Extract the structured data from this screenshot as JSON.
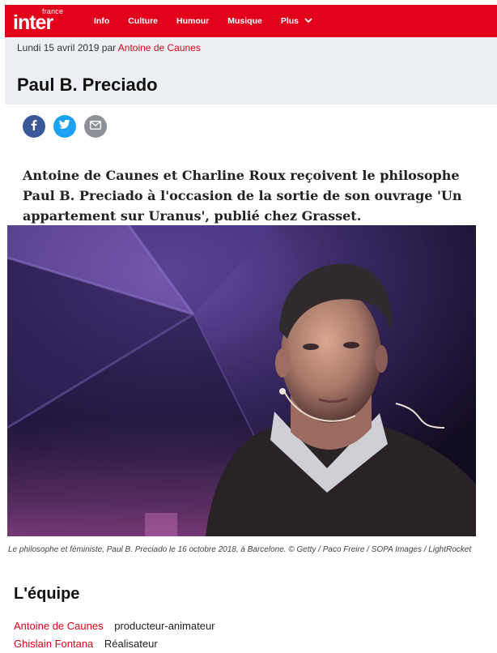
{
  "brand": {
    "small": "france",
    "big": "inter",
    "color": "#e2001a"
  },
  "nav": {
    "items": [
      "Info",
      "Culture",
      "Humour",
      "Musique"
    ],
    "plus_label": "Plus"
  },
  "article": {
    "date": "Lundi 15 avril 2019",
    "by": "par",
    "author": "Antoine de Caunes",
    "title": "Paul B. Preciado",
    "chapo": "Antoine de Caunes et Charline Roux reçoivent le philosophe Paul B. Preciado à l'occasion de la sortie de son ouvrage 'Un appartement sur Uranus', publié chez Grasset.",
    "caption": "Le philosophe et féministe, Paul B. Preciado le 16 octobre 2018, à Barcelone. © Getty / Paco Freire / SOPA Images / LightRocket"
  },
  "share": {
    "icons": [
      "facebook-icon",
      "twitter-icon",
      "mail-icon"
    ],
    "colors": {
      "facebook": "#3b5998",
      "twitter": "#1da1f2",
      "mail": "#8d9299"
    }
  },
  "team": {
    "title": "L'équipe",
    "members": [
      {
        "name": "Antoine de Caunes",
        "role": "producteur-animateur"
      },
      {
        "name": "Ghislain Fontana",
        "role": "Réalisateur"
      }
    ]
  }
}
